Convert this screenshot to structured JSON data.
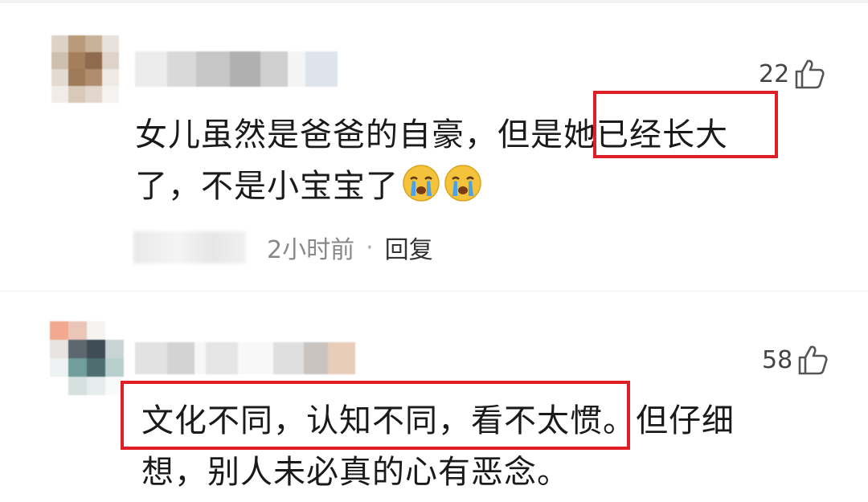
{
  "comments": [
    {
      "likes": "22",
      "text_lines": [
        "女儿虽然是爸爸的自豪，但是她已经长大",
        "了，不是小宝宝了"
      ],
      "emoji": [
        "crying-face",
        "crying-face"
      ],
      "time": "2小时前",
      "separator": "·",
      "reply_label": "回复"
    },
    {
      "likes": "58",
      "text_lines": [
        "文化不同，认知不同，看不太惯。但仔细",
        "想，别人未必真的心有恶念。"
      ]
    }
  ],
  "colors": {
    "highlight_border": "#e01e25",
    "meta_text": "#888888",
    "body_text": "#1a1a1a"
  }
}
